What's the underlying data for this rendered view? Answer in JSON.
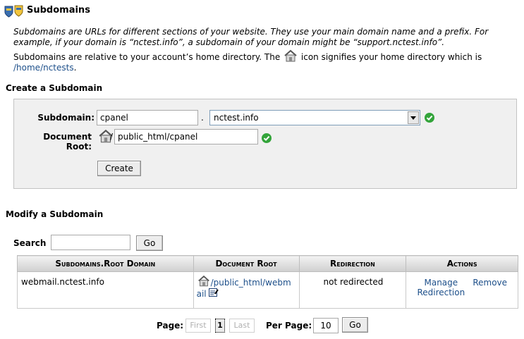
{
  "header": {
    "title": "Subdomains"
  },
  "intro": {
    "text": "Subdomains are URLs for different sections of your website. They use your main domain name and a prefix. For example, if your domain is “nctest.info”, a subdomain of your domain might be “support.nctest.info”.",
    "home_before": "Subdomains are relative to your account’s home directory. The",
    "home_after": "icon signifies your home directory which is",
    "home_path": "/home/nctests",
    "home_end": "."
  },
  "create": {
    "heading": "Create a Subdomain",
    "subdomain_label": "Subdomain:",
    "subdomain_value": "cpanel",
    "dot": ".",
    "domain_selected": "nctest.info",
    "docroot_label": "Document Root:",
    "docroot_value": "public_html/cpanel",
    "slash": "/",
    "create_button": "Create"
  },
  "modify": {
    "heading": "Modify a Subdomain",
    "search_label": "Search",
    "search_value": "",
    "go_button": "Go",
    "columns": [
      "Subdomains.Root Domain",
      "Document Root",
      "Redirection",
      "Actions"
    ],
    "rows": [
      {
        "subdomain": "webmail.nctest.info",
        "docroot_line1": "/public_html/webm",
        "docroot_line2": "ail",
        "redirection": "not redirected",
        "action_manage_line1": "Manage",
        "action_manage_line2": "Redirection",
        "action_remove": "Remove"
      }
    ]
  },
  "pagination": {
    "page_label": "Page:",
    "first": "First",
    "current": "1",
    "last": "Last",
    "per_page_label": "Per Page:",
    "per_page_value": "10",
    "go_button": "Go"
  },
  "colors": {
    "link": "#1d4f8a",
    "check": "#33a43a",
    "panel": "#f0f0f0"
  }
}
